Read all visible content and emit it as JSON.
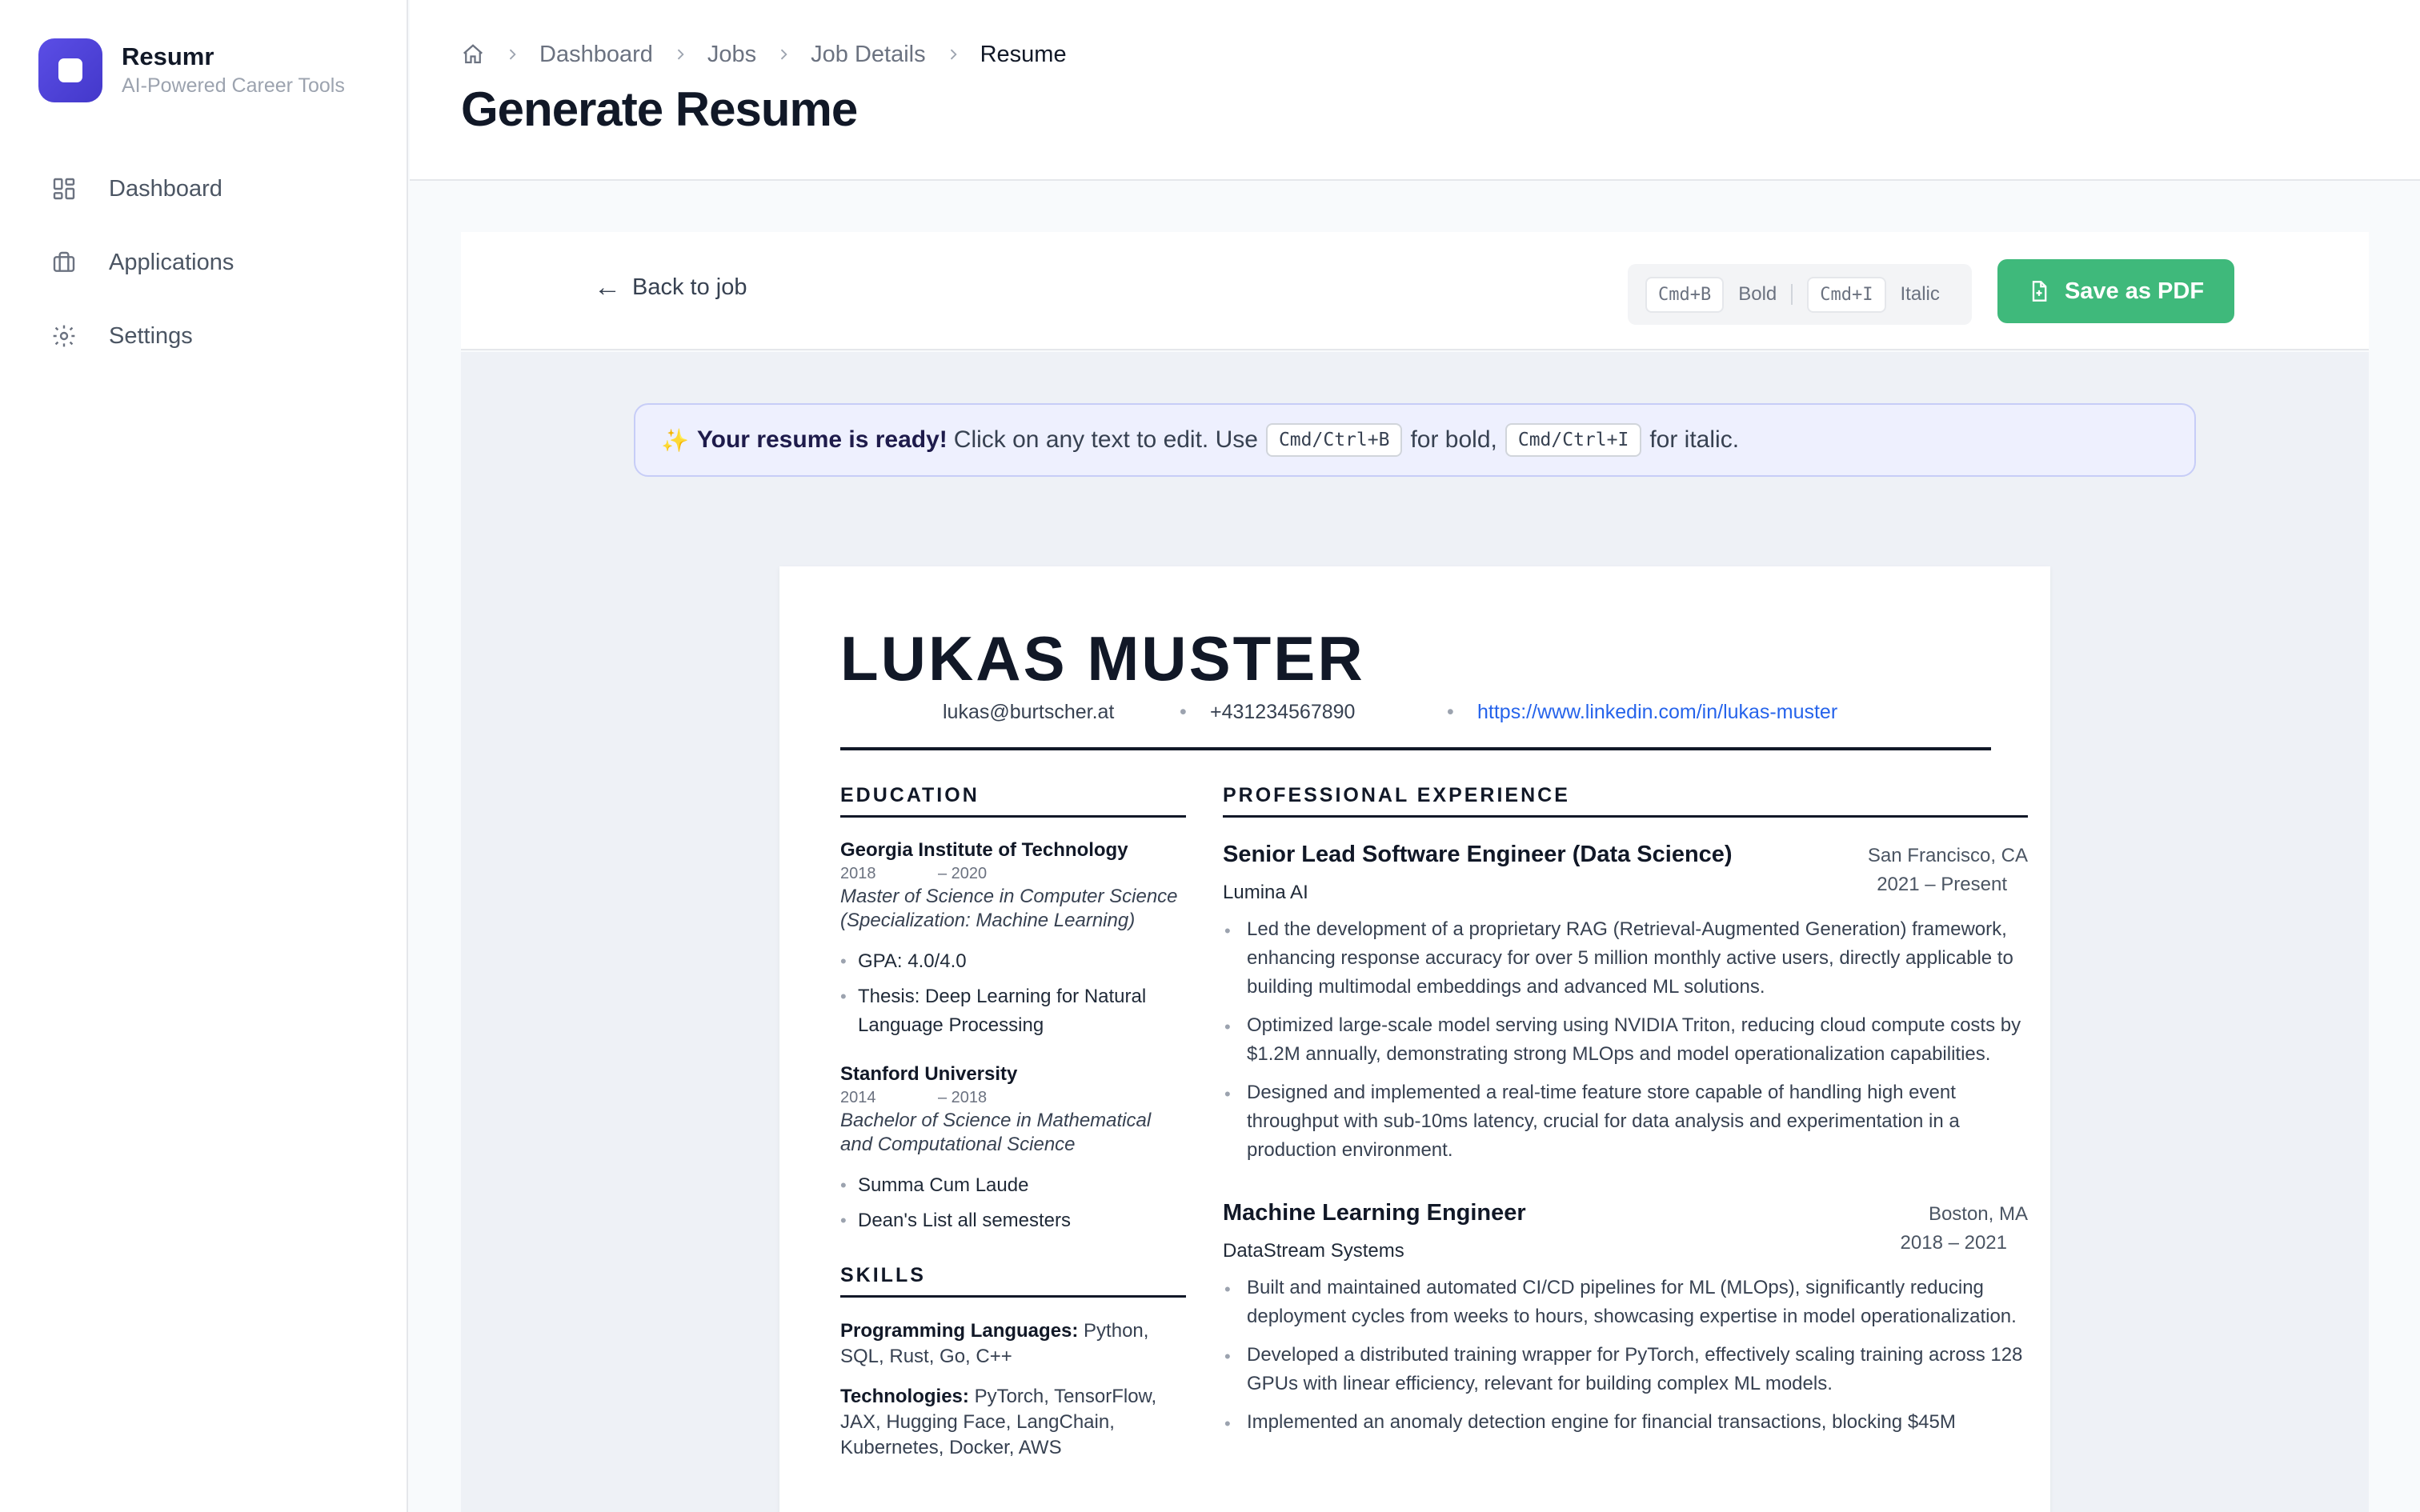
{
  "brand": {
    "name": "Resumr",
    "tagline": "AI-Powered Career Tools",
    "accent": "#4f46e5"
  },
  "sidebar": {
    "items": [
      {
        "label": "Dashboard",
        "icon": "grid-icon"
      },
      {
        "label": "Applications",
        "icon": "briefcase-icon"
      },
      {
        "label": "Settings",
        "icon": "gear-icon"
      }
    ]
  },
  "header": {
    "breadcrumb": [
      "Dashboard",
      "Jobs",
      "Job Details",
      "Resume"
    ],
    "title": "Generate Resume"
  },
  "toolbar": {
    "back_label": "Back to job",
    "shortcut_bold_key": "Cmd+B",
    "shortcut_bold_label": "Bold",
    "shortcut_italic_key": "Cmd+I",
    "shortcut_italic_label": "Italic",
    "save_label": "Save as PDF",
    "save_color": "#3fb97b"
  },
  "notice": {
    "icon": "✨",
    "strong": "Your resume is ready!",
    "text1": "Click on any text to edit. Use",
    "key_bold": "Cmd/Ctrl+B",
    "text2": "for bold,",
    "key_italic": "Cmd/Ctrl+I",
    "text3": "for italic."
  },
  "resume": {
    "name": "LUKAS MUSTER",
    "email": "lukas@burtscher.at",
    "phone": "+431234567890",
    "linkedin": "https://www.linkedin.com/in/lukas-muster",
    "education_title": "EDUCATION",
    "education": [
      {
        "school": "Georgia Institute of Technology",
        "start": "2018",
        "end": "– 2020",
        "degree": "Master of Science in Computer Science (Specialization: Machine Learning)",
        "bullets": [
          "GPA: 4.0/4.0",
          "Thesis: Deep Learning for Natural Language Processing"
        ]
      },
      {
        "school": "Stanford University",
        "start": "2014",
        "end": "– 2018",
        "degree": "Bachelor of Science in Mathematical and Computational Science",
        "bullets": [
          "Summa Cum Laude",
          "Dean's List all semesters"
        ]
      }
    ],
    "skills_title": "SKILLS",
    "skills": [
      {
        "label": "Programming Languages:",
        "value": "Python, SQL, Rust, Go, C++"
      },
      {
        "label": "Technologies:",
        "value": "PyTorch, TensorFlow, JAX, Hugging Face, LangChain, Kubernetes, Docker, AWS"
      }
    ],
    "experience_title": "PROFESSIONAL EXPERIENCE",
    "experience": [
      {
        "title": "Senior Lead Software Engineer (Data Science)",
        "location": "San Francisco, CA",
        "company": "Lumina AI",
        "dates": "2021 – Present",
        "bullets": [
          "Led the development of a proprietary RAG (Retrieval-Augmented Generation) framework, enhancing response accuracy for over 5 million monthly active users, directly applicable to building multimodal embeddings and advanced ML solutions.",
          "Optimized large-scale model serving using NVIDIA Triton, reducing cloud compute costs by $1.2M annually, demonstrating strong MLOps and model operationalization capabilities.",
          "Designed and implemented a real-time feature store capable of handling high event throughput with sub-10ms latency, crucial for data analysis and experimentation in a production environment."
        ]
      },
      {
        "title": "Machine Learning Engineer",
        "location": "Boston, MA",
        "company": "DataStream Systems",
        "dates": "2018 – 2021",
        "bullets": [
          "Built and maintained automated CI/CD pipelines for ML (MLOps), significantly reducing deployment cycles from weeks to hours, showcasing expertise in model operationalization.",
          "Developed a distributed training wrapper for PyTorch, effectively scaling training across 128 GPUs with linear efficiency, relevant for building complex ML models.",
          "Implemented an anomaly detection engine for financial transactions, blocking $45M"
        ]
      }
    ]
  }
}
